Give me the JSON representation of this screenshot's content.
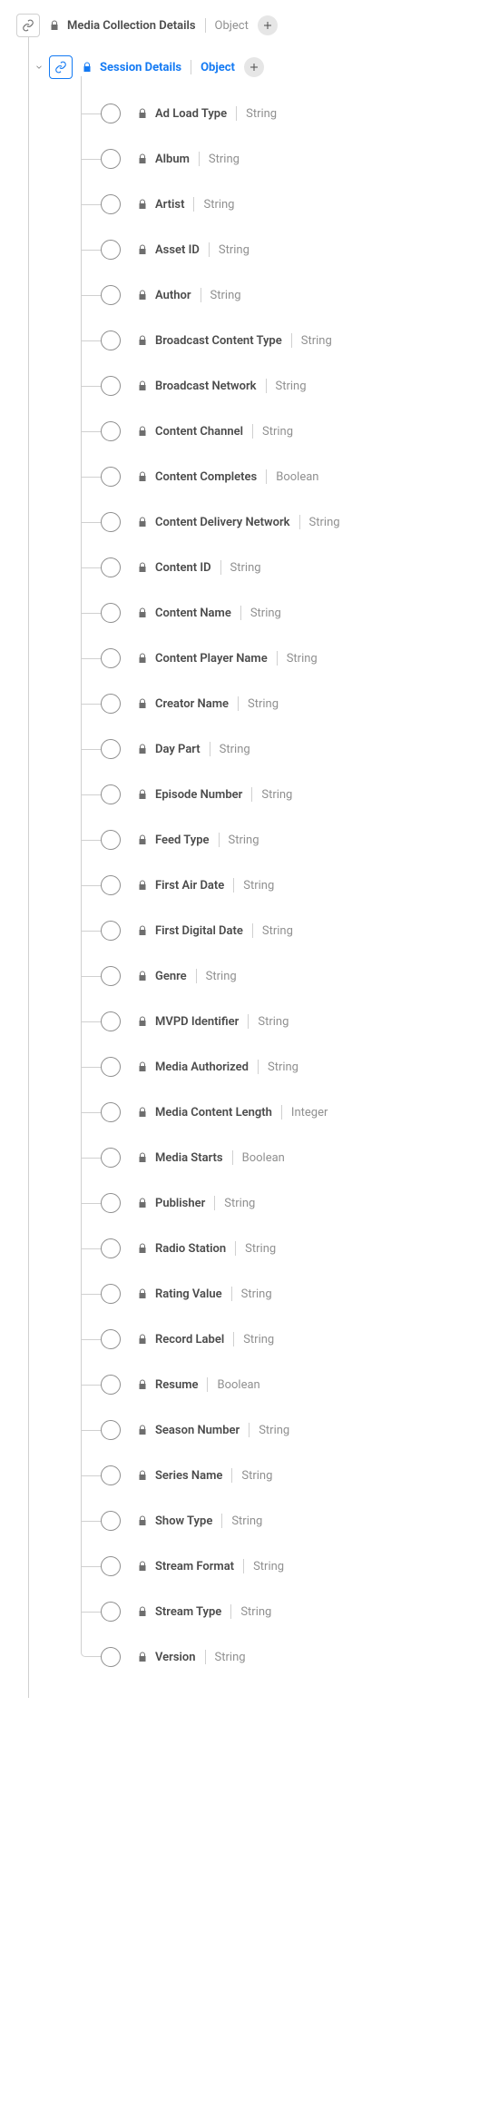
{
  "root": {
    "label": "Media Collection Details",
    "type": "Object"
  },
  "session": {
    "label": "Session Details",
    "type": "Object"
  },
  "fields": [
    {
      "label": "Ad Load Type",
      "type": "String"
    },
    {
      "label": "Album",
      "type": "String"
    },
    {
      "label": "Artist",
      "type": "String"
    },
    {
      "label": "Asset ID",
      "type": "String"
    },
    {
      "label": "Author",
      "type": "String"
    },
    {
      "label": "Broadcast Content Type",
      "type": "String"
    },
    {
      "label": "Broadcast Network",
      "type": "String"
    },
    {
      "label": "Content Channel",
      "type": "String"
    },
    {
      "label": "Content Completes",
      "type": "Boolean"
    },
    {
      "label": "Content Delivery Network",
      "type": "String"
    },
    {
      "label": "Content ID",
      "type": "String"
    },
    {
      "label": "Content Name",
      "type": "String"
    },
    {
      "label": "Content Player Name",
      "type": "String"
    },
    {
      "label": "Creator Name",
      "type": "String"
    },
    {
      "label": "Day Part",
      "type": "String"
    },
    {
      "label": "Episode Number",
      "type": "String"
    },
    {
      "label": "Feed Type",
      "type": "String"
    },
    {
      "label": "First Air Date",
      "type": "String"
    },
    {
      "label": "First Digital Date",
      "type": "String"
    },
    {
      "label": "Genre",
      "type": "String"
    },
    {
      "label": "MVPD Identifier",
      "type": "String"
    },
    {
      "label": "Media Authorized",
      "type": "String"
    },
    {
      "label": "Media Content Length",
      "type": "Integer"
    },
    {
      "label": "Media Starts",
      "type": "Boolean"
    },
    {
      "label": "Publisher",
      "type": "String"
    },
    {
      "label": "Radio Station",
      "type": "String"
    },
    {
      "label": "Rating Value",
      "type": "String"
    },
    {
      "label": "Record Label",
      "type": "String"
    },
    {
      "label": "Resume",
      "type": "Boolean"
    },
    {
      "label": "Season Number",
      "type": "String"
    },
    {
      "label": "Series Name",
      "type": "String"
    },
    {
      "label": "Show Type",
      "type": "String"
    },
    {
      "label": "Stream Format",
      "type": "String"
    },
    {
      "label": "Stream Type",
      "type": "String"
    },
    {
      "label": "Version",
      "type": "String"
    }
  ]
}
